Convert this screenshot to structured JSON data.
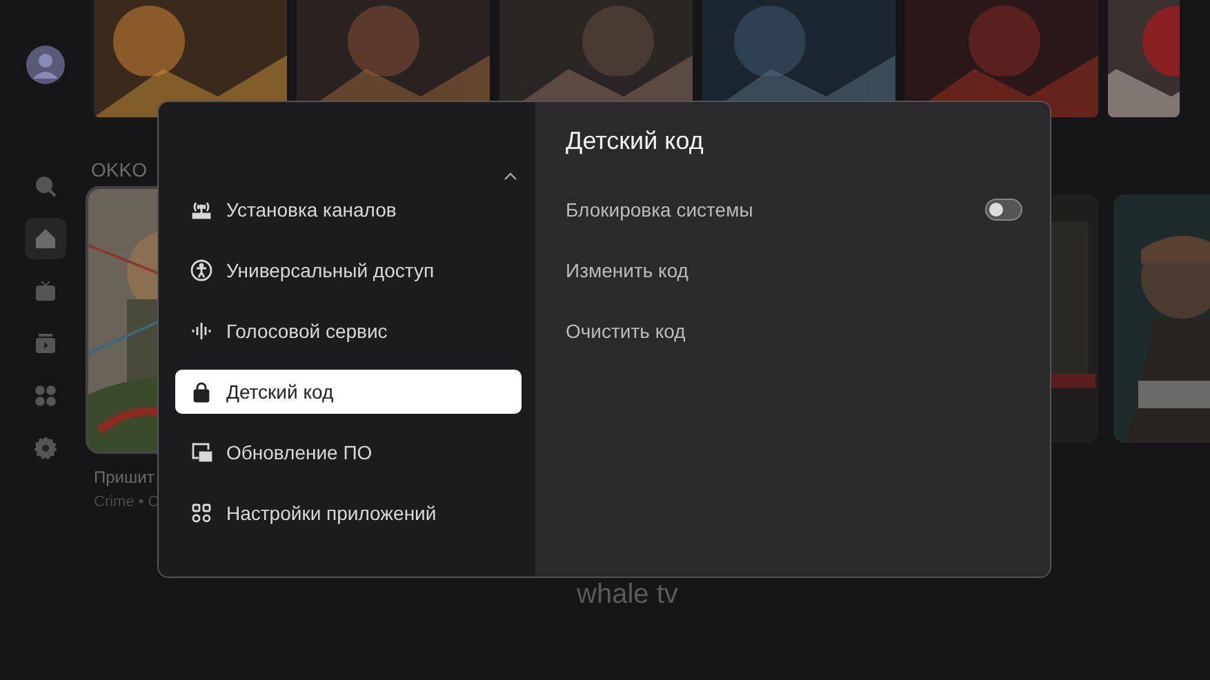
{
  "sidebar": {
    "items": [
      {
        "kind": "avatar",
        "selected": false
      },
      {
        "kind": "search",
        "selected": false
      },
      {
        "kind": "home",
        "selected": true
      },
      {
        "kind": "tv",
        "selected": false
      },
      {
        "kind": "store",
        "selected": false
      },
      {
        "kind": "apps",
        "selected": false
      },
      {
        "kind": "settings",
        "selected": false
      }
    ]
  },
  "section_title": "OKKO",
  "featured": {
    "title": "Пришит",
    "subtitle": "Crime • C"
  },
  "brand": "whale tv",
  "dialog": {
    "menu": [
      {
        "kind": "antenna",
        "label": "Установка каналов",
        "selected": false
      },
      {
        "kind": "accessibility",
        "label": "Универсальный доступ",
        "selected": false
      },
      {
        "kind": "voice",
        "label": "Голосовой сервис",
        "selected": false
      },
      {
        "kind": "lock",
        "label": "Детский код",
        "selected": true
      },
      {
        "kind": "update",
        "label": "Обновление ПО",
        "selected": false
      },
      {
        "kind": "apps",
        "label": "Настройки приложений",
        "selected": false
      }
    ],
    "title": "Детский код",
    "options": [
      {
        "kind": "toggle",
        "label": "Блокировка системы",
        "on": false
      },
      {
        "kind": "action",
        "label": "Изменить код"
      },
      {
        "kind": "action",
        "label": "Очистить код"
      }
    ]
  }
}
